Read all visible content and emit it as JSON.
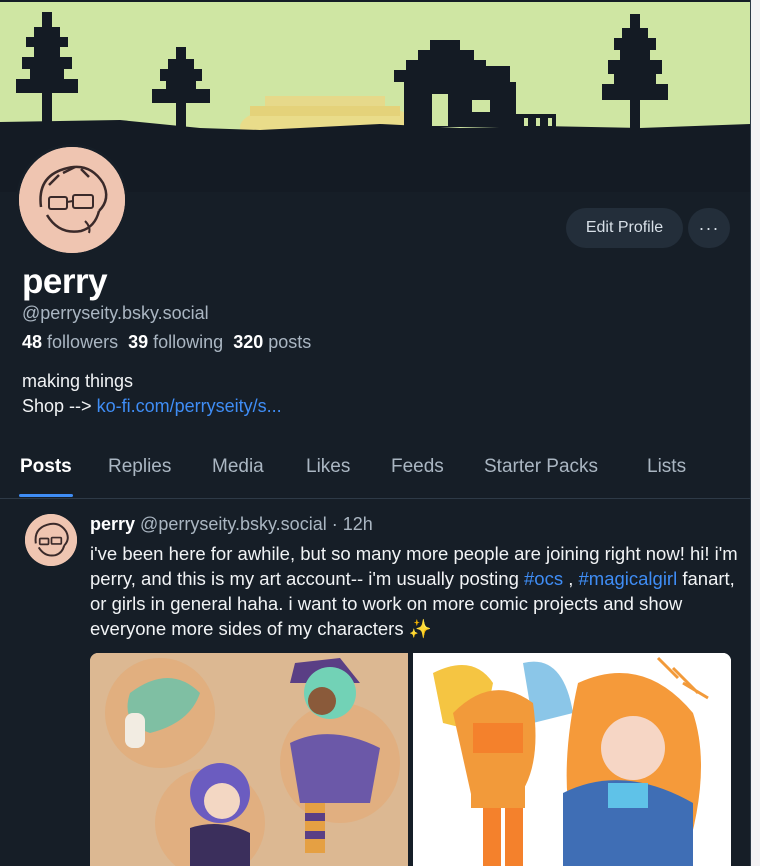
{
  "profile": {
    "name": "perry",
    "handle": "@perryseity.bsky.social",
    "followers_count": "48",
    "followers_label": "followers",
    "following_count": "39",
    "following_label": "following",
    "posts_count": "320",
    "posts_label": "posts",
    "bio_line1": "making things",
    "bio_shop_prefix": "Shop -->",
    "bio_link": "ko-fi.com/perryseity/s..."
  },
  "actions": {
    "edit_profile": "Edit Profile",
    "more": "···"
  },
  "tabs": [
    "Posts",
    "Replies",
    "Media",
    "Likes",
    "Feeds",
    "Starter Packs",
    "Lists"
  ],
  "active_tab": "Posts",
  "post": {
    "author": "perry",
    "handle": "@perryseity.bsky.social",
    "separator": "·",
    "time": "12h",
    "text_part1": "i've been here for awhile, but so many more people are joining right now! hi! i'm perry, and this is my art account-- i'm usually posting",
    "tag1": "#ocs",
    "text_part2": ",",
    "tag2": "#magicalgirl",
    "text_part3": "fanart, or girls in general haha. i want to work on more comic projects and show everyone more sides of my characters",
    "emoji": "✨"
  },
  "colors": {
    "background": "#161e27",
    "accent_link": "#3f8df5",
    "muted_text": "#aab6c2",
    "banner_sky": "#cfe6a3"
  },
  "icons": [
    "more-options-icon",
    "sparkles-emoji"
  ]
}
